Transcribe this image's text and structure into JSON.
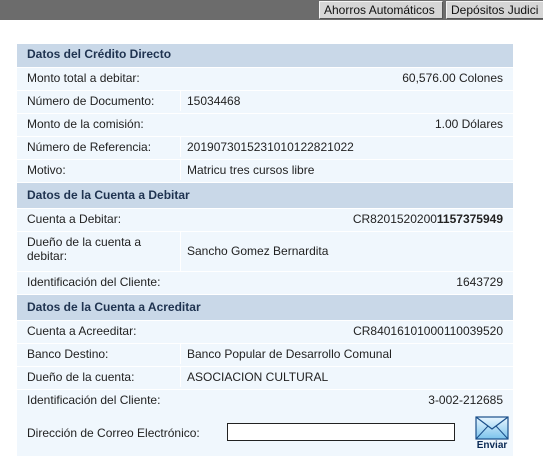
{
  "topbar": {
    "tabs": [
      "Ahorros Automáticos",
      "Depósitos Judici"
    ]
  },
  "credito": {
    "header": "Datos del Crédito Directo",
    "rows": [
      {
        "label": "Monto total a debitar:",
        "value": "60,576.00 Colones"
      },
      {
        "label": "Número de Documento:",
        "value": "15034468"
      },
      {
        "label": "Monto de la comisión:",
        "value": "1.00 Dólares"
      },
      {
        "label": "Número de Referencia:",
        "value": "2019073015231010122821022"
      },
      {
        "label": "Motivo:",
        "value": "Matricu tres cursos libre"
      }
    ]
  },
  "debitar": {
    "header": "Datos de la Cuenta a Debitar",
    "cuenta_label": "Cuenta a Debitar:",
    "cuenta_prefix": "CR8201520200",
    "cuenta_bold": "1157375949",
    "dueno_label": "Dueño de la cuenta a debitar:",
    "dueno_value": "Sancho Gomez Bernardita",
    "id_label": "Identificación del Cliente:",
    "id_value": "1643729"
  },
  "acreditar": {
    "header": "Datos de la Cuenta a Acreditar",
    "rows": [
      {
        "label": "Cuenta a Acreeditar:",
        "value": "CR84016101000110039520"
      },
      {
        "label": "Banco Destino:",
        "value": "Banco Popular de Desarrollo Comunal"
      },
      {
        "label": "Dueño de la cuenta:",
        "value": "ASOCIACION CULTURAL"
      },
      {
        "label": "Identificación del Cliente:",
        "value": "3-002-212685"
      }
    ]
  },
  "email": {
    "label": "Dirección de Correo Electrónico:",
    "value": "",
    "send_label": "Enviar"
  }
}
